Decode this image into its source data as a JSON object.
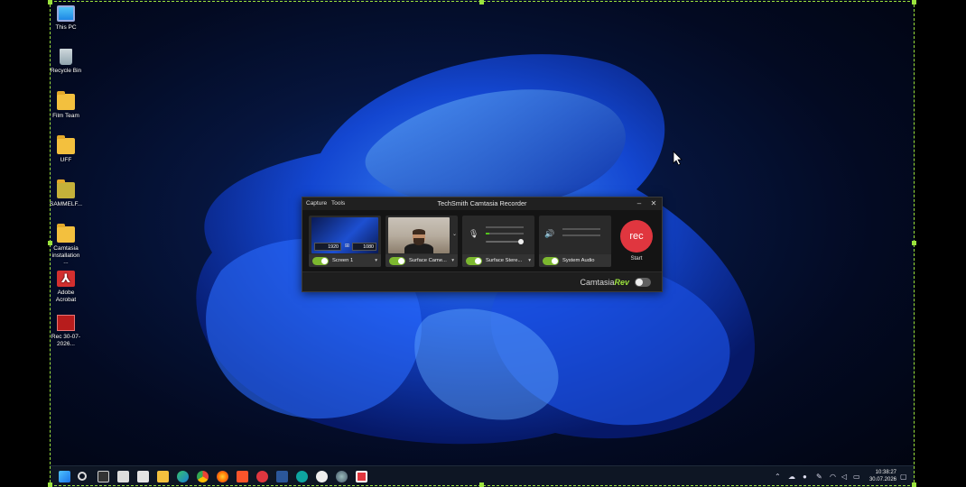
{
  "desktop": {
    "icons": [
      {
        "name": "this-pc",
        "label": "This PC"
      },
      {
        "name": "recycle-bin",
        "label": "Recycle Bin"
      },
      {
        "name": "film-team",
        "label": "Film Team"
      },
      {
        "name": "uff",
        "label": "UFF"
      },
      {
        "name": "sammelf",
        "label": "SAMMELF..."
      },
      {
        "name": "camtasia-installation",
        "label": "Camtasia installation ..."
      },
      {
        "name": "adobe-acrobat",
        "label": "Adobe Acrobat"
      },
      {
        "name": "rec-file",
        "label": "Rec 30-07-2026..."
      }
    ]
  },
  "recorder": {
    "menu": [
      "Capture",
      "Tools"
    ],
    "title": "TechSmith Camtasia Recorder",
    "minimize": "–",
    "close": "✕",
    "screen": {
      "label": "Screen 1",
      "width": "1920",
      "height": "1080",
      "enabled": true
    },
    "camera": {
      "label": "Surface Came...",
      "enabled": true
    },
    "microphone": {
      "label": "Surface Stere...",
      "enabled": true
    },
    "system_audio": {
      "label": "System Audio",
      "enabled": true
    },
    "rec_button": "rec",
    "start_label": "Start",
    "rev_brand": "Camtasia",
    "rev_word": "Rev",
    "rev_enabled": false
  },
  "taskbar": {
    "time": "10:38:27",
    "date": "30.07.2026"
  }
}
